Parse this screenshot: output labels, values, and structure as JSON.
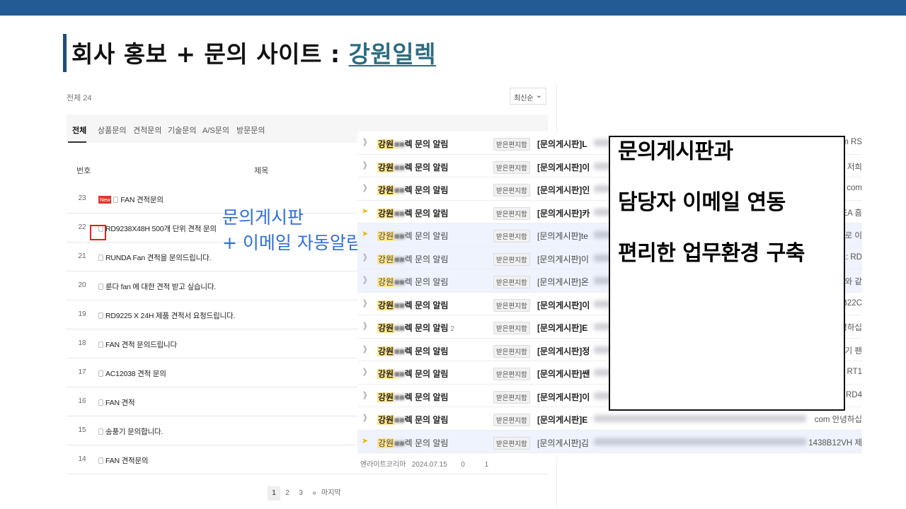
{
  "slide": {
    "title_prefix": "회사 홍보 + 문의 사이트 : ",
    "title_brand": "강원일렉"
  },
  "board": {
    "total": "전체 24",
    "sort": "최신순",
    "tabs": [
      "전체",
      "상품문의",
      "견적문의",
      "기술문의",
      "A/S문의",
      "방문문의"
    ],
    "columns": {
      "number": "번호",
      "title": "제목"
    },
    "new_badge": "New",
    "rows": [
      {
        "num": "23",
        "title": "FAN 견적문의"
      },
      {
        "num": "22",
        "title": "RD9238X48H 500개 단위 견적 문의"
      },
      {
        "num": "21",
        "title": "RUNDA Fan 견적을 문의드립니다."
      },
      {
        "num": "20",
        "title": "룬다 fan 에 대한 견적 받고 싶습니다."
      },
      {
        "num": "19",
        "title": "RD9225 X 24H 제품 견적서 요청드립니다."
      },
      {
        "num": "18",
        "title": "FAN 견적 문의드립니다"
      },
      {
        "num": "17",
        "title": "AC12038 견적 문의"
      },
      {
        "num": "16",
        "title": "FAN 견적"
      },
      {
        "num": "15",
        "title": "송풍기 문의합니다."
      },
      {
        "num": "14",
        "title": "FAN 견적문의"
      }
    ],
    "last_row_meta": {
      "author": "엔라이트코리아",
      "date": "2024.07.15",
      "views": "0",
      "comments": "1"
    },
    "pager": {
      "pages": [
        "1",
        "2",
        "3"
      ],
      "next": "»",
      "last": "마지막"
    }
  },
  "annotation": {
    "line1": "문의게시판",
    "line2": "+ 이메일 자동알림"
  },
  "mail": {
    "sender_hl": "강원",
    "sender_tail": "렉",
    "sender_suffix": " 문의 알림",
    "tag": "받은편지함",
    "subject_prefix": "[문의게시판]",
    "rows": [
      {
        "starred": false,
        "read": false,
        "subj_start": "L",
        "tail": "m RS",
        "count": ""
      },
      {
        "starred": false,
        "read": false,
        "subj_start": "이",
        "tail": "저희",
        "count": ""
      },
      {
        "starred": false,
        "read": false,
        "subj_start": "인",
        "tail": "com",
        "count": ""
      },
      {
        "starred": true,
        "read": false,
        "subj_start": "카",
        "tail": "EA 흠",
        "count": ""
      },
      {
        "starred": true,
        "read": true,
        "subj_start": "te",
        "tail": "로 이",
        "count": ""
      },
      {
        "starred": false,
        "read": true,
        "subj_start": "이",
        "tail": "1: RD",
        "count": ""
      },
      {
        "starred": false,
        "read": true,
        "subj_start": "온",
        "tail": "와 같",
        "count": ""
      },
      {
        "starred": false,
        "read": false,
        "subj_start": "이",
        "tail": "B22C",
        "count": ""
      },
      {
        "starred": false,
        "read": false,
        "subj_start": "E",
        "tail": "녕하십",
        "count": "2"
      },
      {
        "starred": false,
        "read": false,
        "subj_start": "정",
        "tail": "기 팬",
        "count": ""
      },
      {
        "starred": false,
        "read": false,
        "subj_start": "쌘",
        "tail": "n RT1",
        "count": ""
      },
      {
        "starred": false,
        "read": false,
        "subj_start": "이",
        "tail": "RD4",
        "count": ""
      },
      {
        "starred": false,
        "read": false,
        "subj_start": "E",
        "tail": "com 안녕하십",
        "count": ""
      },
      {
        "starred": true,
        "read": true,
        "subj_start": "김",
        "tail": "1438B12VH 제",
        "count": ""
      }
    ]
  },
  "callout": {
    "line1": "문의게시판과",
    "line2": "담당자 이메일 연동",
    "line3": "편리한 업무환경 구축"
  },
  "colors": {
    "top_bar": "#225b95",
    "brand": "#2e6c80",
    "annotation": "#2f6fd8",
    "highlight": "#e32121"
  }
}
